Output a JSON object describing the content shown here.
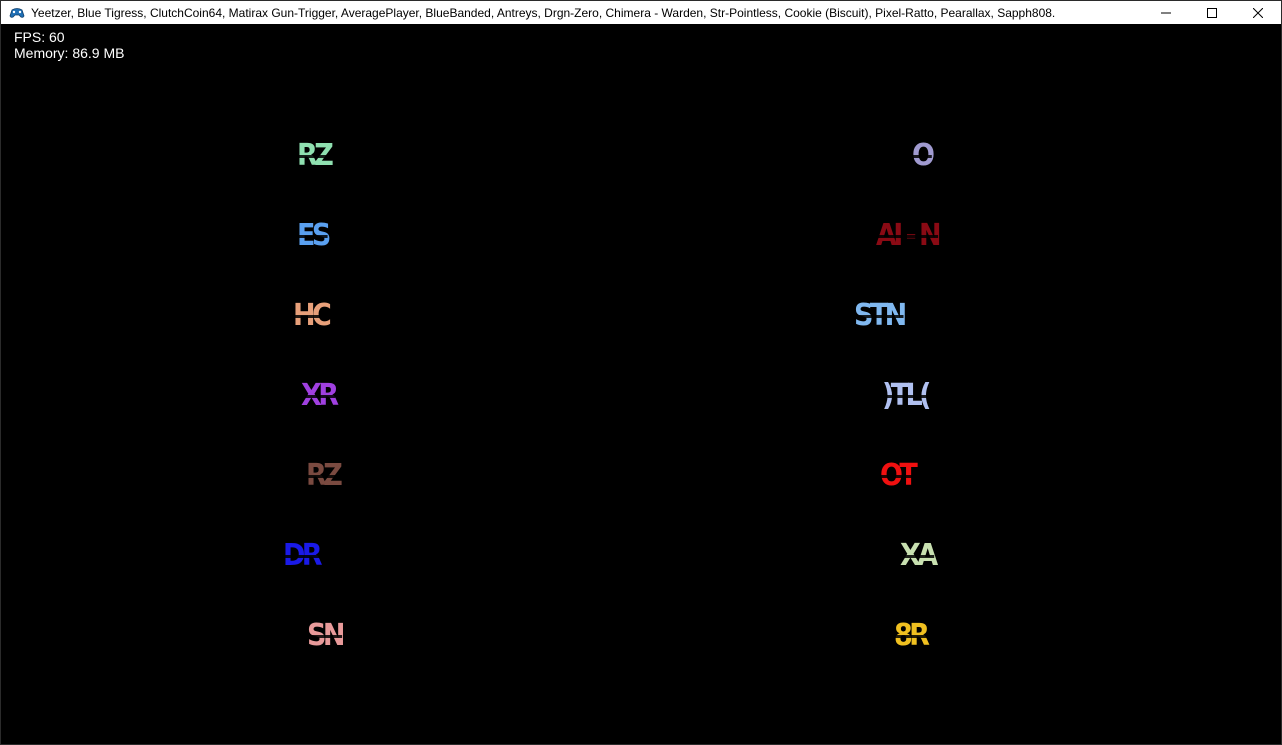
{
  "window": {
    "title": "Yeetzer, Blue Tigress, ClutchCoin64, Matirax Gun-Trigger, AveragePlayer, BlueBanded, Antreys, Drgn-Zero, Chimera - Warden, Str-Pointless, Cookie (Biscuit), Pixel-Ratto, Pearallax, Sapph808.",
    "app_icon": "game-controller-icon",
    "buttons": {
      "minimize": "minimize-icon",
      "maximize": "maximize-icon",
      "close": "close-icon"
    }
  },
  "stats": {
    "fps": "FPS: 60",
    "memory": "Memory: 86.9 MB"
  },
  "tags": [
    {
      "id": "left-1",
      "text": "RZ",
      "color": "#8fe0b0"
    },
    {
      "id": "left-2",
      "text": "ES",
      "color": "#5aa0f0"
    },
    {
      "id": "left-3",
      "text": "HC",
      "color": "#e8a07a"
    },
    {
      "id": "left-4",
      "text": "XR",
      "color": "#a040e0"
    },
    {
      "id": "left-5",
      "text": "RZ",
      "color": "#7a4a40"
    },
    {
      "id": "left-6",
      "text": "DR",
      "color": "#1a1ae8"
    },
    {
      "id": "left-7",
      "text": "SN",
      "color": "#e89a9a"
    },
    {
      "id": "right-1",
      "text": "O",
      "color": "#a09ad0"
    },
    {
      "id": "right-2",
      "text": "AI - N",
      "color": "#8a0a14"
    },
    {
      "id": "right-3",
      "text": "STN",
      "color": "#80b8f0"
    },
    {
      "id": "right-4",
      "text": ")TL(",
      "color": "#b0c0f0"
    },
    {
      "id": "right-5",
      "text": "OT",
      "color": "#f01010"
    },
    {
      "id": "right-6",
      "text": "XA",
      "color": "#c8e0b0"
    },
    {
      "id": "right-7",
      "text": "8R",
      "color": "#f0c020"
    }
  ]
}
